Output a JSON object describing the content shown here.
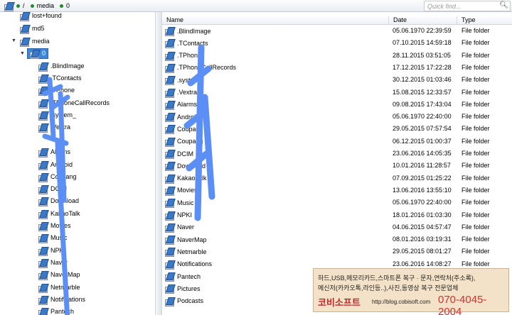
{
  "breadcrumb": {
    "root": "/",
    "items": [
      "media",
      "0"
    ]
  },
  "search": {
    "placeholder": "Quick find..."
  },
  "tree": {
    "items": [
      {
        "label": "lost+found"
      },
      {
        "label": "md5"
      },
      {
        "label": "media"
      },
      {
        "label": "0"
      },
      {
        "label": ".BlindImage"
      },
      {
        "label": ".TContacts"
      },
      {
        "label": ".TPhone"
      },
      {
        "label": ".TPhoneCallRecords"
      },
      {
        "label": ".system_"
      },
      {
        "label": ".Vextra"
      },
      {
        "label": "Alarms"
      },
      {
        "label": "Android"
      },
      {
        "label": "Coupang"
      },
      {
        "label": "DCIM"
      },
      {
        "label": "Download"
      },
      {
        "label": "KakaoTalk"
      },
      {
        "label": "Movies"
      },
      {
        "label": "Music"
      },
      {
        "label": "NPKI"
      },
      {
        "label": "Naver"
      },
      {
        "label": "NaverMap"
      },
      {
        "label": "Netmarble"
      },
      {
        "label": "Notifications"
      },
      {
        "label": "Pantech"
      }
    ]
  },
  "table": {
    "headers": {
      "name": "Name",
      "date": "Date",
      "type": "Type"
    },
    "rows": [
      {
        "name": ".BlindImage",
        "date": "05.06.1970 22:39:59",
        "type": "File folder"
      },
      {
        "name": ".TContacts",
        "date": "07.10.2015 14:59:18",
        "type": "File folder"
      },
      {
        "name": ".TPhone",
        "date": "28.11.2015 03:51:05",
        "type": "File folder"
      },
      {
        "name": ".TPhoneCallRecords",
        "date": "17.12.2015 17:22:28",
        "type": "File folder"
      },
      {
        "name": ".system_",
        "date": "30.12.2015 01:03:46",
        "type": "File folder"
      },
      {
        "name": ".Vextra",
        "date": "15.08.2015 12:33:57",
        "type": "File folder"
      },
      {
        "name": "Alarms",
        "date": "09.08.2015 17:43:04",
        "type": "File folder"
      },
      {
        "name": "Android",
        "date": "05.06.1970 22:40:00",
        "type": "File folder"
      },
      {
        "name": "Coupang",
        "date": "29.05.2015 07:57:54",
        "type": "File folder"
      },
      {
        "name": "Coupang",
        "date": "06.12.2015 01:00:37",
        "type": "File folder"
      },
      {
        "name": "DCIM",
        "date": "23.06.2016 14:05:35",
        "type": "File folder"
      },
      {
        "name": "Download",
        "date": "10.01.2016 11:28:57",
        "type": "File folder"
      },
      {
        "name": "KakaoTalk",
        "date": "07.09.2015 01:25:22",
        "type": "File folder"
      },
      {
        "name": "Movies",
        "date": "13.06.2016 13:55:10",
        "type": "File folder"
      },
      {
        "name": "Music",
        "date": "05.06.1970 22:40:00",
        "type": "File folder"
      },
      {
        "name": "NPKI",
        "date": "18.01.2016 01:03:30",
        "type": "File folder"
      },
      {
        "name": "Naver",
        "date": "04.06.2015 04:57:47",
        "type": "File folder"
      },
      {
        "name": "NaverMap",
        "date": "08.01.2016 03:19:31",
        "type": "File folder"
      },
      {
        "name": "Netmarble",
        "date": "29.05.2015 08:01:27",
        "type": "File folder"
      },
      {
        "name": "Notifications",
        "date": "23.06.2016 14:08:27",
        "type": "File folder"
      },
      {
        "name": "Pantech",
        "date": "",
        "type": ""
      },
      {
        "name": "Pictures",
        "date": "",
        "type": ""
      },
      {
        "name": "Podcasts",
        "date": "",
        "type": ""
      }
    ]
  },
  "ad": {
    "line1": "하드,USB,메모리카드,스마트폰 복구 · 문자,연락처(주소록),",
    "line2": "메신저(카카오톡,라인등..),사진,동영상 복구 전문업체",
    "brand": "코비소프트",
    "url": "http://blog.cobisoft.com",
    "phone": "070-4045-2004"
  },
  "colors": {
    "selection": "#3b86d8",
    "scribble": "#5b8ff5",
    "ad_background": "#f3e2c7",
    "ad_accent": "#c1272d"
  }
}
